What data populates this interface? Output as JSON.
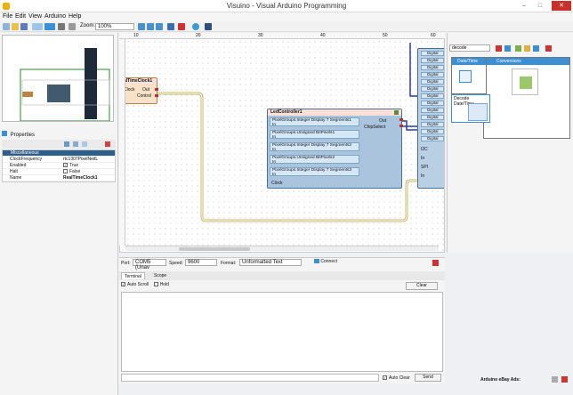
{
  "window": {
    "title": "Visuino - Visual Arduino Programming",
    "minimize": "–",
    "maximize": "□",
    "close": "✕"
  },
  "menu": [
    "File",
    "Edit",
    "View",
    "Arduino",
    "Help"
  ],
  "toolbar": {
    "zoom_label": "Zoom:",
    "zoom_value": "100%"
  },
  "properties": {
    "title": "Properties",
    "category": "Miscellaneous",
    "rows": [
      {
        "key": "ClockFrequency",
        "value": "rtc1307PixelNeitL"
      },
      {
        "key": "Enabled",
        "value": "True"
      },
      {
        "key": "Halt",
        "value": "False"
      },
      {
        "key": "Name",
        "value": "RealTimeClock1"
      }
    ]
  },
  "canvas": {
    "ruler_ticks": [
      "10",
      "20",
      "30",
      "40",
      "50",
      "60"
    ],
    "rtc": {
      "title": "alTimeClock1",
      "out": "Out",
      "clock": "Clock",
      "control": "Control"
    },
    "lcd": {
      "title": "LedController1",
      "out": "Out",
      "chip_select": "ChipSelect",
      "elements": [
        "PixelGroups.Integer Display 7 Segments1",
        "PixelGroups.Unsigned BitPixels1",
        "PixelGroups.Integer Display 7 Segments2",
        "PixelGroups.Unsigned BitPixels2",
        "PixelGroups.Integer Display 7 Segments3"
      ],
      "in_label": "In",
      "clock_label": "Clock"
    },
    "board_pins": [
      "Digital",
      "Digital",
      "Digital",
      "Digital",
      "Digital",
      "Digital",
      "Digital",
      "Digital",
      "Digital",
      "Digital",
      "Digital",
      "Digital",
      "Digital"
    ],
    "board_labels": [
      "I2C",
      "In",
      "SPI",
      "In"
    ]
  },
  "components_panel": {
    "search_value": "decode",
    "cards": [
      {
        "head": "Date/Time"
      },
      {
        "head": "Conversions"
      },
      {
        "head": "Decode Date/Time"
      }
    ]
  },
  "serial": {
    "port_label": "Port:",
    "port_value": "COM5 (Unav",
    "speed_label": "Speed:",
    "speed_value": "9600",
    "format_label": "Format:",
    "format_value": "Unformatted Text",
    "connect_label": "Connect",
    "tabs": [
      "Terminal",
      "Scope"
    ],
    "auto_scroll": "Auto Scroll",
    "hold": "Hold",
    "clear": "Clear",
    "auto_clear": "Auto Clear",
    "send": "Send"
  },
  "status": {
    "ads": "Arduino eBay Ads:"
  },
  "colors": {
    "accent": "#3b8fd5",
    "wire_yellow": "#c9b86a",
    "wire_blue": "#2b3fa0",
    "close_red": "#c9302c"
  }
}
